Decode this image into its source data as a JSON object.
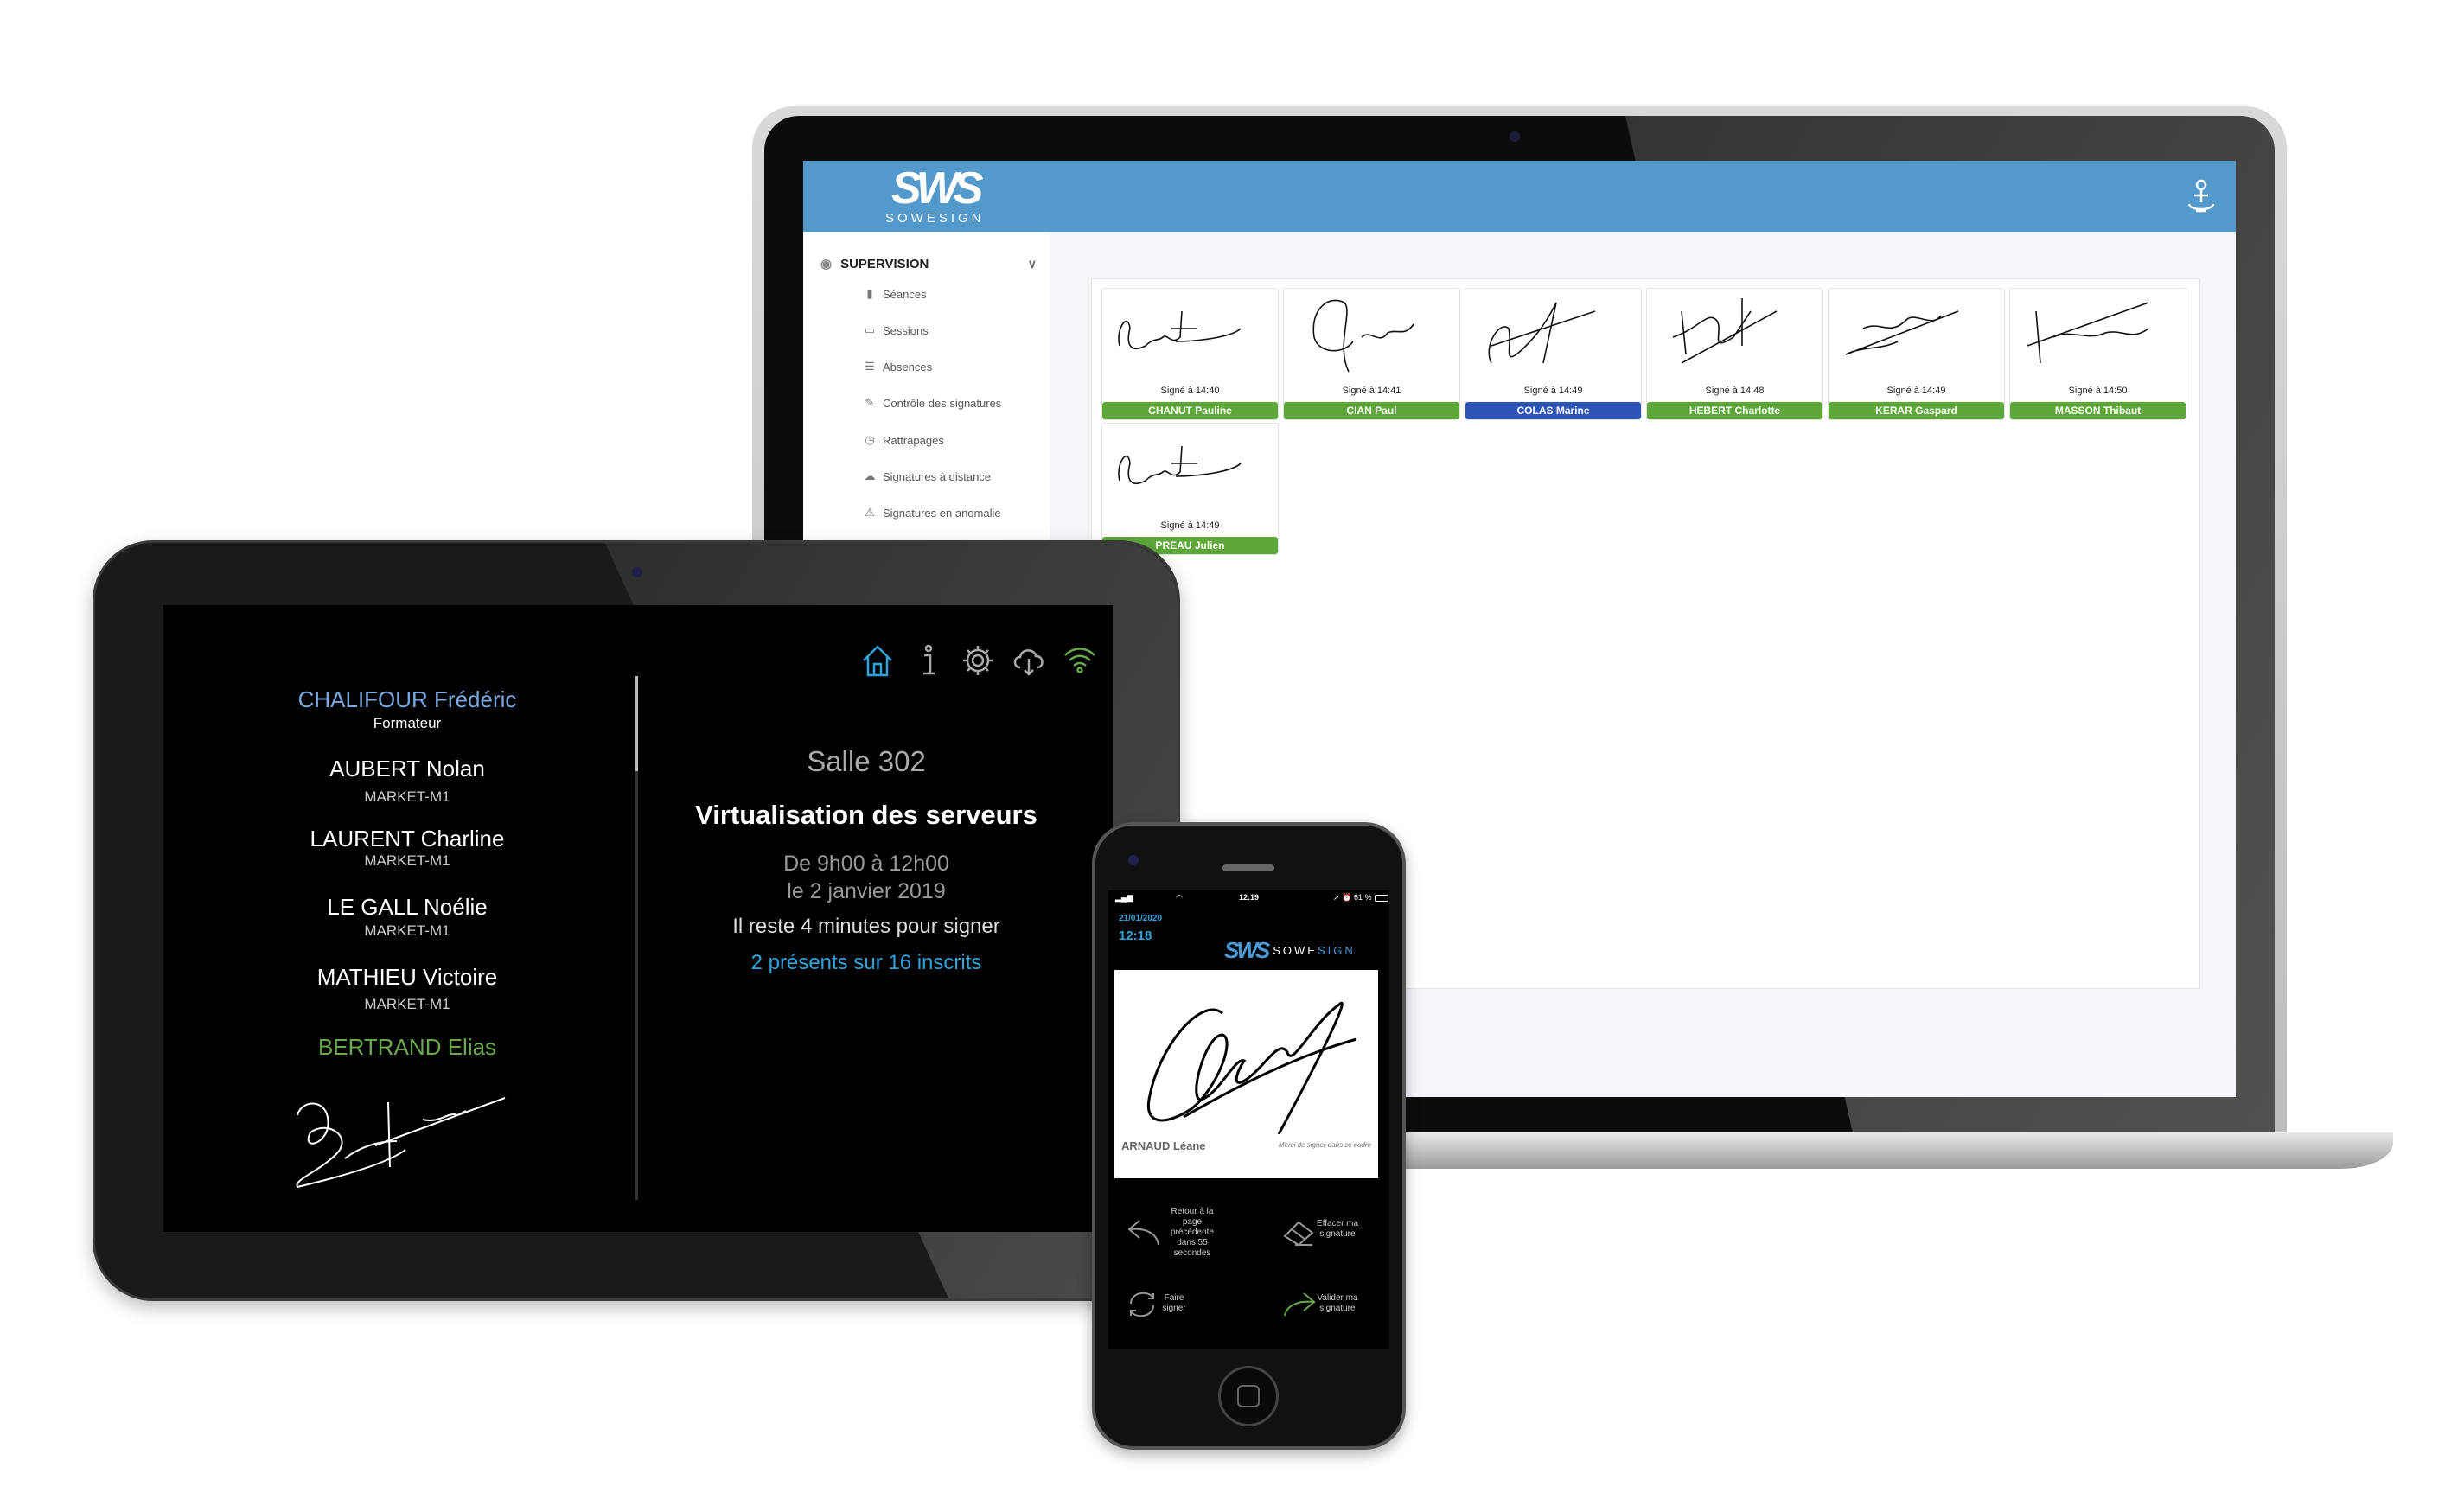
{
  "laptop": {
    "brand": {
      "mark": "SWS",
      "word": "SOWESIGN"
    },
    "header_icon": "user-icon",
    "header_color": "#5499cc",
    "sidebar": {
      "section": "SUPERVISION",
      "items": [
        {
          "label": "Séances",
          "icon": "book-icon"
        },
        {
          "label": "Sessions",
          "icon": "calendar-icon"
        },
        {
          "label": "Absences",
          "icon": "list-icon"
        },
        {
          "label": "Contrôle des signatures",
          "icon": "pen-icon"
        },
        {
          "label": "Rattrapages",
          "icon": "clock-icon"
        },
        {
          "label": "Signatures à distance",
          "icon": "cloud-icon"
        },
        {
          "label": "Signatures en anomalie",
          "icon": "warning-icon"
        }
      ]
    },
    "signatures": [
      {
        "signed": "Signé à 14:40",
        "name": "CHANUT Pauline",
        "status_color": "#5ea83a"
      },
      {
        "signed": "Signé à 14:41",
        "name": "CIAN Paul",
        "status_color": "#5ea83a"
      },
      {
        "signed": "Signé à 14:49",
        "name": "COLAS Marine",
        "status_color": "#2d55b8"
      },
      {
        "signed": "Signé à 14:48",
        "name": "HEBERT Charlotte",
        "status_color": "#5ea83a"
      },
      {
        "signed": "Signé à 14:49",
        "name": "KERAR Gaspard",
        "status_color": "#5ea83a"
      },
      {
        "signed": "Signé à 14:50",
        "name": "MASSON Thibaut",
        "status_color": "#5ea83a"
      },
      {
        "signed": "Signé à 14:49",
        "name": "PREAU Julien",
        "status_color": "#5ea83a"
      }
    ]
  },
  "tablet": {
    "toolbar_icons": [
      "home-icon",
      "info-icon",
      "gear-icon",
      "cloud-download-icon",
      "wifi-icon"
    ],
    "trainer": {
      "name": "CHALIFOUR Frédéric",
      "role": "Formateur"
    },
    "attendees": [
      {
        "name": "AUBERT Nolan",
        "group": "MARKET-M1"
      },
      {
        "name": "LAURENT Charline",
        "group": "MARKET-M1"
      },
      {
        "name": "LE GALL Noélie",
        "group": "MARKET-M1"
      },
      {
        "name": "MATHIEU Victoire",
        "group": "MARKET-M1"
      }
    ],
    "signing": {
      "name": "BERTRAND Elias"
    },
    "room": "Salle 302",
    "course": "Virtualisation des serveurs",
    "time": "De 9h00 à 12h00",
    "date": "le 2 janvier 2019",
    "remaining": "Il reste 4 minutes pour signer",
    "attendance": "2 présents sur 16 inscrits",
    "colors": {
      "trainer": "#7aa7e0",
      "signing": "#6aa84f",
      "attendance": "#2fa3dc"
    }
  },
  "phone": {
    "status": {
      "time": "12:19",
      "battery": "61 %"
    },
    "date": "21/01/2020",
    "clock": "12:18",
    "brand": {
      "mark": "SWS",
      "word_a": "SOWE",
      "word_b": "SIGN"
    },
    "signer": "ARNAUD Léane",
    "hint": "Merci de signer dans ce cadre",
    "back": "Retour à la page précédente dans 55 secondes",
    "erase": "Effacer ma signature",
    "switch": "Faire signer",
    "validate": "Valider ma signature"
  }
}
